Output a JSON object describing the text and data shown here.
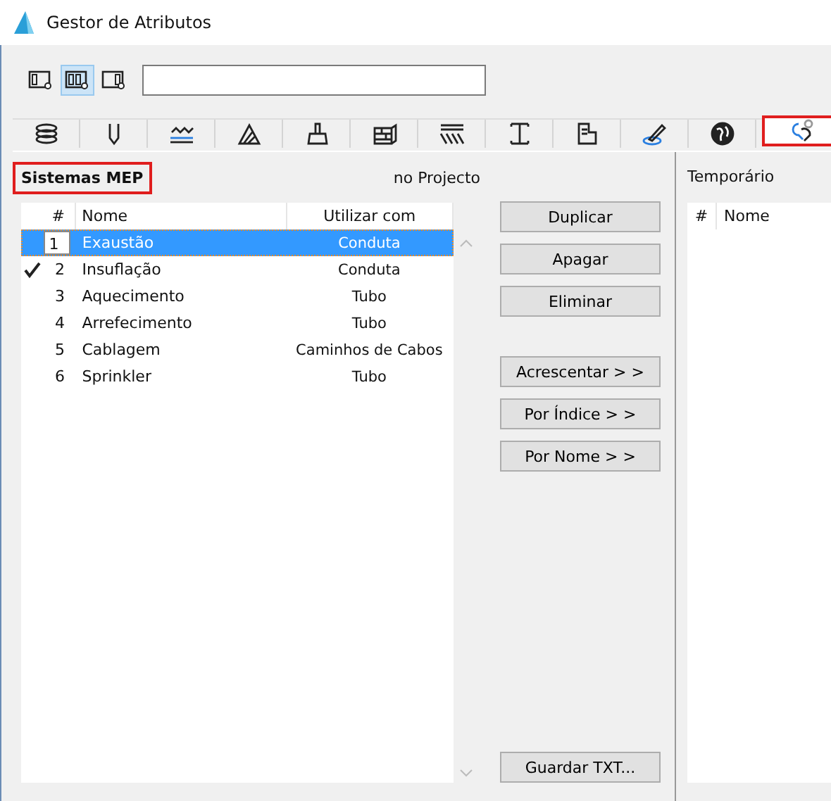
{
  "window": {
    "title": "Gestor de Atributos"
  },
  "view_modes": [
    {
      "selected": false
    },
    {
      "selected": true
    },
    {
      "selected": false
    }
  ],
  "tabs": [
    {
      "selected": false
    },
    {
      "selected": false
    },
    {
      "selected": false
    },
    {
      "selected": false
    },
    {
      "selected": false
    },
    {
      "selected": false
    },
    {
      "selected": false
    },
    {
      "selected": false
    },
    {
      "selected": false
    },
    {
      "selected": false
    },
    {
      "selected": false
    },
    {
      "selected": true
    }
  ],
  "left_panel": {
    "title": "Sistemas MEP",
    "subtitle": "no Projecto",
    "columns": [
      "#",
      "Nome",
      "Utilizar com"
    ],
    "rows": [
      {
        "index": "1",
        "name": "Exaustão",
        "use_with": "Conduta",
        "checked": false,
        "selected": true
      },
      {
        "index": "2",
        "name": "Insuflação",
        "use_with": "Conduta",
        "checked": true,
        "selected": false
      },
      {
        "index": "3",
        "name": "Aquecimento",
        "use_with": "Tubo",
        "checked": false,
        "selected": false
      },
      {
        "index": "4",
        "name": "Arrefecimento",
        "use_with": "Tubo",
        "checked": false,
        "selected": false
      },
      {
        "index": "5",
        "name": "Cablagem",
        "use_with": "Caminhos de Cabos",
        "checked": false,
        "selected": false
      },
      {
        "index": "6",
        "name": "Sprinkler",
        "use_with": "Tubo",
        "checked": false,
        "selected": false
      }
    ]
  },
  "actions_top": [
    "Duplicar",
    "Apagar",
    "Eliminar"
  ],
  "actions_transfer": [
    "Acrescentar > >",
    "Por Índice > >",
    "Por Nome > >"
  ],
  "actions_bottom": [
    "Guardar TXT..."
  ],
  "right_panel": {
    "title": "Temporário",
    "columns": [
      "#",
      "Nome"
    ]
  }
}
